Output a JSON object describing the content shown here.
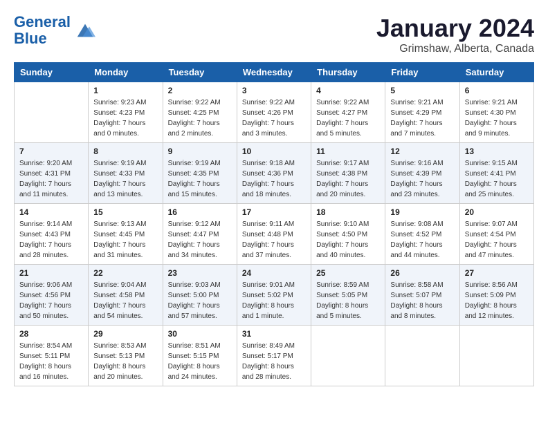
{
  "header": {
    "logo_line1": "General",
    "logo_line2": "Blue",
    "title": "January 2024",
    "subtitle": "Grimshaw, Alberta, Canada"
  },
  "calendar": {
    "days_of_week": [
      "Sunday",
      "Monday",
      "Tuesday",
      "Wednesday",
      "Thursday",
      "Friday",
      "Saturday"
    ],
    "weeks": [
      [
        {
          "day": "",
          "info": ""
        },
        {
          "day": "1",
          "info": "Sunrise: 9:23 AM\nSunset: 4:23 PM\nDaylight: 7 hours\nand 0 minutes."
        },
        {
          "day": "2",
          "info": "Sunrise: 9:22 AM\nSunset: 4:25 PM\nDaylight: 7 hours\nand 2 minutes."
        },
        {
          "day": "3",
          "info": "Sunrise: 9:22 AM\nSunset: 4:26 PM\nDaylight: 7 hours\nand 3 minutes."
        },
        {
          "day": "4",
          "info": "Sunrise: 9:22 AM\nSunset: 4:27 PM\nDaylight: 7 hours\nand 5 minutes."
        },
        {
          "day": "5",
          "info": "Sunrise: 9:21 AM\nSunset: 4:29 PM\nDaylight: 7 hours\nand 7 minutes."
        },
        {
          "day": "6",
          "info": "Sunrise: 9:21 AM\nSunset: 4:30 PM\nDaylight: 7 hours\nand 9 minutes."
        }
      ],
      [
        {
          "day": "7",
          "info": "Sunrise: 9:20 AM\nSunset: 4:31 PM\nDaylight: 7 hours\nand 11 minutes."
        },
        {
          "day": "8",
          "info": "Sunrise: 9:19 AM\nSunset: 4:33 PM\nDaylight: 7 hours\nand 13 minutes."
        },
        {
          "day": "9",
          "info": "Sunrise: 9:19 AM\nSunset: 4:35 PM\nDaylight: 7 hours\nand 15 minutes."
        },
        {
          "day": "10",
          "info": "Sunrise: 9:18 AM\nSunset: 4:36 PM\nDaylight: 7 hours\nand 18 minutes."
        },
        {
          "day": "11",
          "info": "Sunrise: 9:17 AM\nSunset: 4:38 PM\nDaylight: 7 hours\nand 20 minutes."
        },
        {
          "day": "12",
          "info": "Sunrise: 9:16 AM\nSunset: 4:39 PM\nDaylight: 7 hours\nand 23 minutes."
        },
        {
          "day": "13",
          "info": "Sunrise: 9:15 AM\nSunset: 4:41 PM\nDaylight: 7 hours\nand 25 minutes."
        }
      ],
      [
        {
          "day": "14",
          "info": "Sunrise: 9:14 AM\nSunset: 4:43 PM\nDaylight: 7 hours\nand 28 minutes."
        },
        {
          "day": "15",
          "info": "Sunrise: 9:13 AM\nSunset: 4:45 PM\nDaylight: 7 hours\nand 31 minutes."
        },
        {
          "day": "16",
          "info": "Sunrise: 9:12 AM\nSunset: 4:47 PM\nDaylight: 7 hours\nand 34 minutes."
        },
        {
          "day": "17",
          "info": "Sunrise: 9:11 AM\nSunset: 4:48 PM\nDaylight: 7 hours\nand 37 minutes."
        },
        {
          "day": "18",
          "info": "Sunrise: 9:10 AM\nSunset: 4:50 PM\nDaylight: 7 hours\nand 40 minutes."
        },
        {
          "day": "19",
          "info": "Sunrise: 9:08 AM\nSunset: 4:52 PM\nDaylight: 7 hours\nand 44 minutes."
        },
        {
          "day": "20",
          "info": "Sunrise: 9:07 AM\nSunset: 4:54 PM\nDaylight: 7 hours\nand 47 minutes."
        }
      ],
      [
        {
          "day": "21",
          "info": "Sunrise: 9:06 AM\nSunset: 4:56 PM\nDaylight: 7 hours\nand 50 minutes."
        },
        {
          "day": "22",
          "info": "Sunrise: 9:04 AM\nSunset: 4:58 PM\nDaylight: 7 hours\nand 54 minutes."
        },
        {
          "day": "23",
          "info": "Sunrise: 9:03 AM\nSunset: 5:00 PM\nDaylight: 7 hours\nand 57 minutes."
        },
        {
          "day": "24",
          "info": "Sunrise: 9:01 AM\nSunset: 5:02 PM\nDaylight: 8 hours\nand 1 minute."
        },
        {
          "day": "25",
          "info": "Sunrise: 8:59 AM\nSunset: 5:05 PM\nDaylight: 8 hours\nand 5 minutes."
        },
        {
          "day": "26",
          "info": "Sunrise: 8:58 AM\nSunset: 5:07 PM\nDaylight: 8 hours\nand 8 minutes."
        },
        {
          "day": "27",
          "info": "Sunrise: 8:56 AM\nSunset: 5:09 PM\nDaylight: 8 hours\nand 12 minutes."
        }
      ],
      [
        {
          "day": "28",
          "info": "Sunrise: 8:54 AM\nSunset: 5:11 PM\nDaylight: 8 hours\nand 16 minutes."
        },
        {
          "day": "29",
          "info": "Sunrise: 8:53 AM\nSunset: 5:13 PM\nDaylight: 8 hours\nand 20 minutes."
        },
        {
          "day": "30",
          "info": "Sunrise: 8:51 AM\nSunset: 5:15 PM\nDaylight: 8 hours\nand 24 minutes."
        },
        {
          "day": "31",
          "info": "Sunrise: 8:49 AM\nSunset: 5:17 PM\nDaylight: 8 hours\nand 28 minutes."
        },
        {
          "day": "",
          "info": ""
        },
        {
          "day": "",
          "info": ""
        },
        {
          "day": "",
          "info": ""
        }
      ]
    ]
  }
}
